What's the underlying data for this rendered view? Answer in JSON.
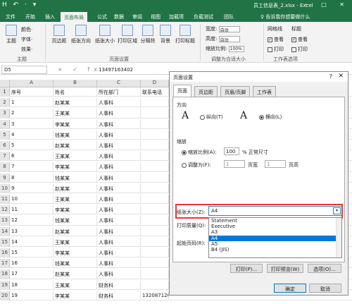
{
  "title_bar": {
    "quick_access": "H ↶ · ▾",
    "filename": "员工信息表_2.xlsx - Excel",
    "window_buttons": "─ □ ✕"
  },
  "tabs": [
    "文件",
    "开始",
    "插入",
    "页面布局",
    "公式",
    "数据",
    "审阅",
    "视图",
    "加载项",
    "负载测试",
    "团队"
  ],
  "tell_me": "♀ 告诉我你想要做什么",
  "ribbon": {
    "theme": {
      "big": "主题",
      "colors": "颜色·",
      "fonts": "字体·",
      "effects": "效果·",
      "group": "主题"
    },
    "page_setup": {
      "margins": "页边距",
      "orientation": "纸张方向",
      "size": "纸张大小",
      "print_area": "打印区域",
      "breaks": "分隔符",
      "background": "背景",
      "print_titles": "打印标题",
      "group": "页面设置"
    },
    "scale": {
      "width_label": "宽度:",
      "width_val": "自动",
      "height_label": "高度:",
      "height_val": "自动",
      "scale_label": "缩放比例:",
      "scale_val": "100%",
      "group": "调整为合适大小"
    },
    "sheet_opts": {
      "gridlines": "网格线",
      "headings": "标题",
      "view": "查看",
      "print": "打印",
      "group": "工作表选项"
    }
  },
  "formula_bar": {
    "name_box": "D5",
    "fx_icons": "× ✓ fx",
    "value": "13497163402"
  },
  "columns": [
    {
      "name": "A",
      "header": "序号"
    },
    {
      "name": "B",
      "header": "姓名"
    },
    {
      "name": "C",
      "header": "所在部门"
    },
    {
      "name": "D",
      "header": "联系电话"
    }
  ],
  "rows": [
    {
      "n": "1",
      "a": "序号",
      "b": "姓名",
      "c": "所在部门",
      "d": "联系电话"
    },
    {
      "n": "2",
      "a": "1",
      "b": "赵某某",
      "c": "人事科",
      "d": ""
    },
    {
      "n": "3",
      "a": "2",
      "b": "王某某",
      "c": "人事科",
      "d": ""
    },
    {
      "n": "4",
      "a": "3",
      "b": "李某某",
      "c": "人事科",
      "d": ""
    },
    {
      "n": "5",
      "a": "4",
      "b": "钱某某",
      "c": "人事科",
      "d": ""
    },
    {
      "n": "6",
      "a": "5",
      "b": "赵某某",
      "c": "人事科",
      "d": ""
    },
    {
      "n": "7",
      "a": "6",
      "b": "王某某",
      "c": "人事科",
      "d": ""
    },
    {
      "n": "8",
      "a": "7",
      "b": "李某某",
      "c": "人事科",
      "d": ""
    },
    {
      "n": "9",
      "a": "8",
      "b": "钱某某",
      "c": "人事科",
      "d": ""
    },
    {
      "n": "10",
      "a": "9",
      "b": "赵某某",
      "c": "人事科",
      "d": ""
    },
    {
      "n": "11",
      "a": "10",
      "b": "王某某",
      "c": "人事科",
      "d": ""
    },
    {
      "n": "12",
      "a": "11",
      "b": "李某某",
      "c": "人事科",
      "d": ""
    },
    {
      "n": "13",
      "a": "12",
      "b": "钱某某",
      "c": "人事科",
      "d": ""
    },
    {
      "n": "14",
      "a": "13",
      "b": "赵某某",
      "c": "人事科",
      "d": ""
    },
    {
      "n": "15",
      "a": "14",
      "b": "王某某",
      "c": "人事科",
      "d": ""
    },
    {
      "n": "16",
      "a": "15",
      "b": "李某某",
      "c": "人事科",
      "d": ""
    },
    {
      "n": "17",
      "a": "16",
      "b": "钱某某",
      "c": "人事科",
      "d": ""
    },
    {
      "n": "18",
      "a": "17",
      "b": "赵某某",
      "c": "人事科",
      "d": ""
    },
    {
      "n": "19",
      "a": "18",
      "b": "王某某",
      "c": "财务科",
      "d": ""
    },
    {
      "n": "20",
      "a": "19",
      "b": "李某某",
      "c": "财务科",
      "d": "13208712631"
    }
  ],
  "dialog": {
    "title": "页面设置",
    "help": "?",
    "close": "✕",
    "tabs": [
      "页面",
      "页边距",
      "页眉/页脚",
      "工作表"
    ],
    "orientation_label": "方向",
    "portrait": "纵向(T)",
    "landscape": "横向(L)",
    "scaling_label": "缩放",
    "adjust_to": "缩放比例(A):",
    "adjust_val": "100",
    "normal_size": "% 正常尺寸",
    "fit_to": "调整为(F):",
    "fit_w": "1",
    "pages_wide": "页宽",
    "fit_h": "1",
    "pages_tall": "页高",
    "paper_size_label": "纸张大小(Z):",
    "paper_size_val": "A4",
    "print_quality_label": "打印质量(Q):",
    "first_page_label": "起始页码(R):",
    "paper_options": [
      "Statement",
      "Executive",
      "A3",
      "A4",
      "A5",
      "B4 (JIS)"
    ],
    "btn_print": "打印(P)...",
    "btn_preview": "打印预览(W)",
    "btn_options": "选项(O)...",
    "btn_ok": "确定",
    "btn_cancel": "取消"
  }
}
